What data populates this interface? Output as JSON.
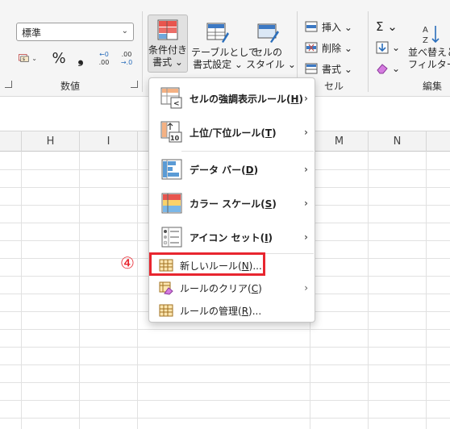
{
  "ribbon": {
    "number_group": {
      "format_value": "標準",
      "label": "数値",
      "icons": [
        "accounting-format-icon",
        "percent-icon",
        "comma-style-icon",
        "increase-decimal-icon",
        "decrease-decimal-icon"
      ],
      "percent": "%",
      "comma": "❟",
      "inc_dec_top": "←0",
      "inc_dec_bottom": ".00",
      "dec_dec_top": ".00",
      "dec_dec_bottom": "→.0"
    },
    "styles_group": {
      "conditional_format_l1": "条件付き",
      "conditional_format_l2": "書式 ⌄",
      "table_format_l1": "テーブルとして",
      "table_format_l2": "書式設定 ⌄",
      "cell_style_l1": "セルの",
      "cell_style_l2": "スタイル ⌄"
    },
    "cells_group": {
      "insert": "挿入 ⌄",
      "delete": "削除 ⌄",
      "format": "書式 ⌄",
      "label": "セル"
    },
    "editing_group": {
      "autosum": "Σ ⌄",
      "fill": "⌄",
      "clear": "⌄",
      "sort_filter_l1": "並べ替えと",
      "sort_filter_l2": "フィルター ⌄",
      "label": "編集"
    }
  },
  "grid": {
    "columns": [
      "H",
      "I",
      "M",
      "N"
    ]
  },
  "conditional_menu": {
    "items": [
      {
        "label": "セルの強調表示ルール(",
        "key": "H",
        "end": ")",
        "icon": "highlight-cells-rules-icon",
        "submenu": true
      },
      {
        "label": "上位/下位ルール(",
        "key": "T",
        "end": ")",
        "icon": "top-bottom-rules-icon",
        "submenu": true
      },
      {
        "label": "データ バー(",
        "key": "D",
        "end": ")",
        "icon": "data-bars-icon",
        "submenu": true
      },
      {
        "label": "カラー スケール(",
        "key": "S",
        "end": ")",
        "icon": "color-scales-icon",
        "submenu": true
      },
      {
        "label": "アイコン セット(",
        "key": "I",
        "end": ")",
        "icon": "icon-sets-icon",
        "submenu": true
      },
      {
        "label": "新しいルール(",
        "key": "N",
        "end": ")...",
        "icon": "new-rule-icon",
        "submenu": false
      },
      {
        "label": "ルールのクリア(",
        "key": "C",
        "end": ")",
        "icon": "clear-rules-icon",
        "submenu": true
      },
      {
        "label": "ルールの管理(",
        "key": "R",
        "end": ")...",
        "icon": "manage-rules-icon",
        "submenu": false
      }
    ],
    "arrow": "›"
  },
  "annotation": {
    "step": "④",
    "color": "#e8262f"
  }
}
